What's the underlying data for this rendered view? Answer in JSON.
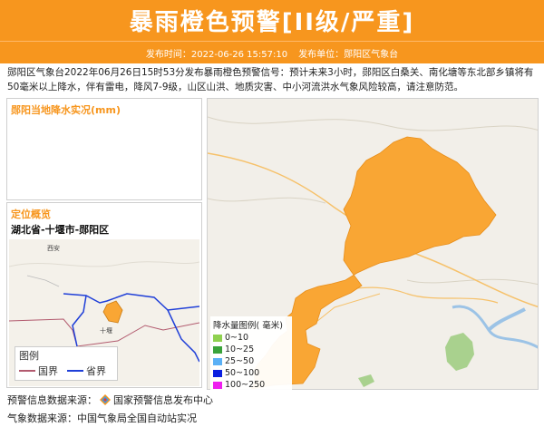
{
  "header": {
    "title": "暴雨橙色预警[II级/严重]"
  },
  "subbar": {
    "time": "发布时间：2022-06-26 15:57:10",
    "unit": "发布单位：郧阳区气象台"
  },
  "description": "郧阳区气象台2022年06月26日15时53分发布暴雨橙色预警信号：预计未来3小时，郧阳区白桑关、南化塘等东北部乡镇将有50毫米以上降水，伴有雷电，降风7-9级，山区山洪、地质灾害、中小河流洪水气象风险较高，请注意防范。",
  "rain_panel": {
    "title": "郧阳当地降水实况(mm)"
  },
  "location_panel": {
    "title": "定位概览",
    "path": "湖北省-十堰市-郧阳区",
    "map_label_1": "西安",
    "map_label_2": "十堰",
    "legend": {
      "title": "图例",
      "national_border": "国界",
      "provincial_border": "省界"
    }
  },
  "scale_legend": {
    "title": "降水量图例( 毫米)",
    "items": [
      {
        "label": "0~10",
        "color": "#8fd14f"
      },
      {
        "label": "10~25",
        "color": "#3aa33a"
      },
      {
        "label": "25~50",
        "color": "#5ab0f5"
      },
      {
        "label": "50~100",
        "color": "#0a1fe0"
      },
      {
        "label": "100~250",
        "color": "#ef1fef"
      }
    ]
  },
  "footer": {
    "warning_source_label": "预警信息数据来源：",
    "warning_source": "国家预警信息发布中心",
    "weather_source": "气象数据来源：中国气象局全国自动站实况"
  },
  "colors": {
    "accent": "#f7961e",
    "warning_area": "#f9a634",
    "national_border": "#b25a6e",
    "provincial_border": "#1f3fd8"
  }
}
